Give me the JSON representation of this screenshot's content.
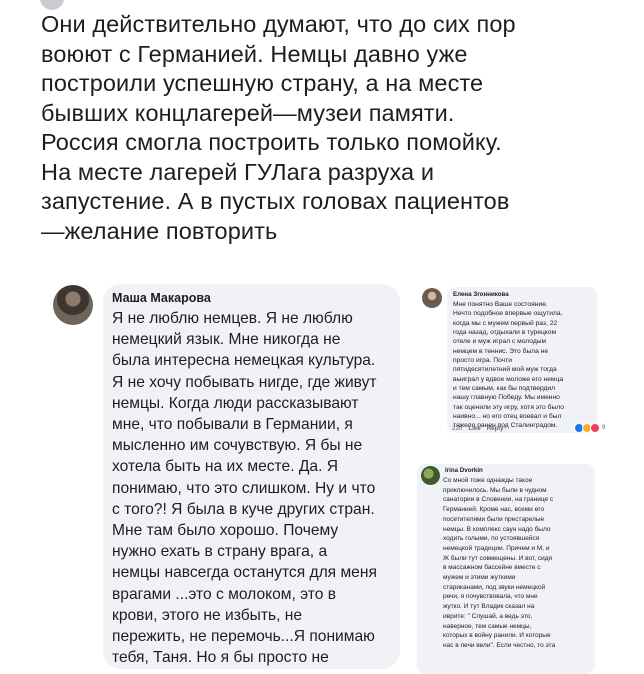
{
  "post": {
    "text": "Они действительно думают, что до сих пор\nвоюют с Германией. Немцы давно уже\nпостроили успешную страну, а на месте\nбывших концлагерей—музеи памяти.\nРоссия смогла построить только помойку.\nНа месте лагерей ГУЛага разруха и\nзапустение. А в пустых головах пациентов\n—желание повторить"
  },
  "comments": {
    "masha": {
      "author": "Маша Макарова",
      "text": "Я не люблю немцев. Я не люблю\nнемецкий язык. Мне никогда не\nбыла интересна немецкая культура.\nЯ не хочу побывать нигде, где живут\nнемцы. Когда люди рассказывают\nмне, что побывали в Германии, я\nмысленно им сочувствую. Я бы не\nхотела быть на их месте. Да. Я\nпонимаю, что это слишком. Ну и что\nс того?! Я была в куче других стран.\nМне там было хорошо. Почему\nнужно ехать в страну врага, а\nнемцы навсегда останутся для меня\nврагами ...это с молоком, это в\nкрови, этого не избыть, не\nпережить, не перемочь...Я понимаю\nтебя, Таня. Но я бы просто не"
    },
    "elena": {
      "author": "Елена Згонникова",
      "text": "Мне понятно Ваше состояние.\nНечто подобное впервые ощутила,\nкогда мы с мужем первый раз, 22\nгода назад, отдыхали в турецком\nотеле и муж играл с молодым\nнемцем в теннис. Это была не\nпросто игра. Почти\nпятидесятилетний мой муж тогда\nвыиграл у вдвое моложе его немца\nи тем самым, как бы подтвердил\nнашу главную Победу. Мы именно\nтак оценили эту игру, хотя это было\nнаивно... но его отец воевал и был\nтяжело ранен под Сталинградом.",
      "time": "22h",
      "like_label": "Like",
      "reply_label": "Reply",
      "reaction_count": "9"
    },
    "irina": {
      "author": "Irina Dvorkin",
      "text": "Со мной тоже однажды такое\nприключилось. Мы были в чудном\nсанатории в Словении, на границе с\nГерманией. Кроме нас, всеми его\nпосетителями были престарелые\nнемцы. В комплекс саун надо было\nходить голыми, по устоявшейся\nнемецкой традиции. Причем и М, и\nЖ были тут совмещены. И вот, сидя\nв массажном бассейне вместе с\nмужем и этими жуткими\nстариканами, под звуки немецкой\nречи, я почувствовала, что мне\nжутко. И тут Владик сказал на\nиврите: \" Слушай, а ведь это,\nнаверное, тем самые немцы,\nкоторых в войну ранили. И которые\nнас в печи вели\". Если честно, то эта"
    }
  }
}
